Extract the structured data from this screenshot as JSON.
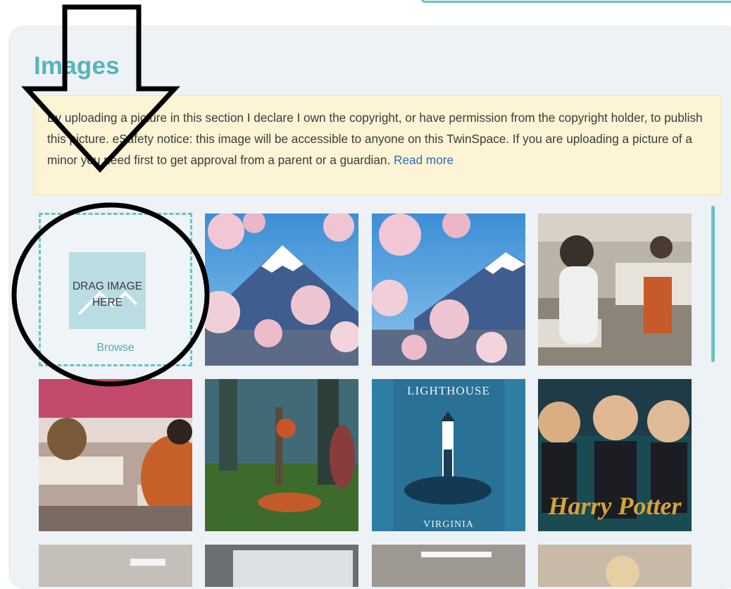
{
  "section": {
    "title": "Images"
  },
  "notice": {
    "text": "By uploading a picture in this section I declare I own the copyright, or have permission from the copyright holder, to publish this picture. eSafety notice: this image will be accessible to anyone on this TwinSpace. If you are uploading a picture of a minor you need first to get approval from a parent or a guardian.",
    "link_label": "Read more"
  },
  "upload": {
    "drag_label": "DRAG IMAGE HERE",
    "browse_label": "Browse"
  },
  "images": {
    "book_cover": {
      "title": "LIGHTHOUSE",
      "author": "VIRGINIA"
    },
    "movie_poster": {
      "title": "Harry Potter"
    }
  },
  "colors": {
    "accent": "#56b4ba",
    "dashed_border": "#6cc1c4",
    "notice_bg": "#fcf4d5",
    "link": "#2f6fb5",
    "panel_bg": "#edf2f7"
  },
  "annotation": {
    "arrow": "down-arrow",
    "circle": "circle-highlight"
  }
}
